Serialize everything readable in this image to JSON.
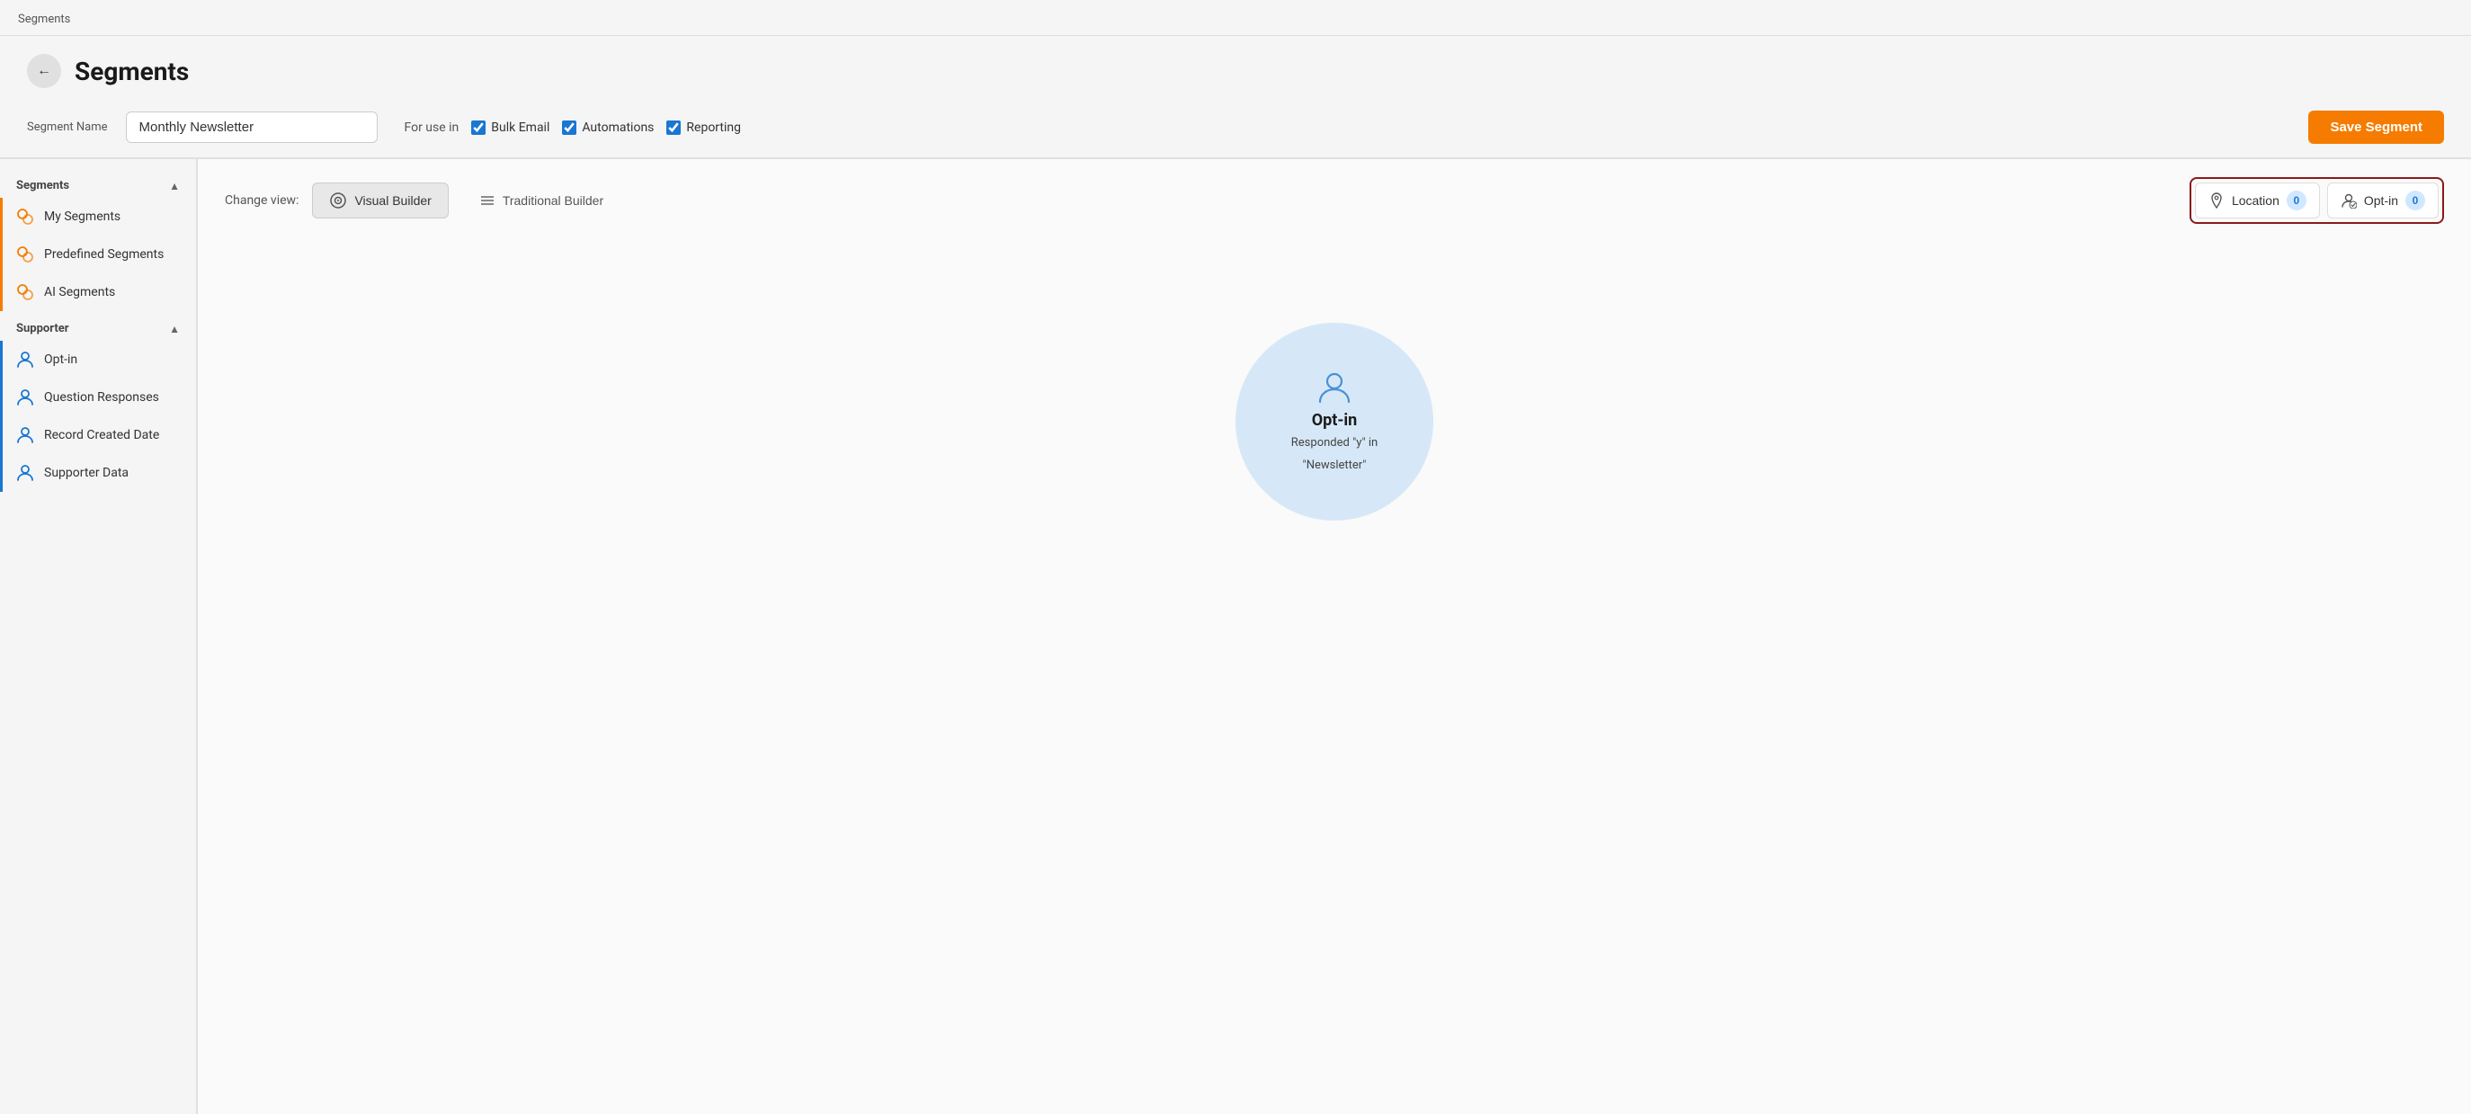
{
  "title_bar": {
    "text": "Segments"
  },
  "header": {
    "back_label": "←",
    "page_title": "Segments"
  },
  "toolbar": {
    "segment_name_label": "Segment Name",
    "segment_name_value": "Monthly Newsletter",
    "segment_name_placeholder": "Enter segment name",
    "for_use_in_label": "For use in",
    "checkboxes": [
      {
        "id": "bulk-email",
        "label": "Bulk Email",
        "checked": true
      },
      {
        "id": "automations",
        "label": "Automations",
        "checked": true
      },
      {
        "id": "reporting",
        "label": "Reporting",
        "checked": true
      }
    ],
    "save_btn_label": "Save Segment"
  },
  "sidebar": {
    "sections": [
      {
        "title": "Segments",
        "items": [
          {
            "id": "my-segments",
            "label": "My Segments",
            "icon_type": "orange"
          },
          {
            "id": "predefined-segments",
            "label": "Predefined Segments",
            "icon_type": "orange"
          },
          {
            "id": "ai-segments",
            "label": "AI Segments",
            "icon_type": "orange"
          }
        ]
      },
      {
        "title": "Supporter",
        "items": [
          {
            "id": "opt-in",
            "label": "Opt-in",
            "icon_type": "blue"
          },
          {
            "id": "question-responses",
            "label": "Question Responses",
            "icon_type": "blue"
          },
          {
            "id": "record-created-date",
            "label": "Record Created Date",
            "icon_type": "blue"
          },
          {
            "id": "supporter-data",
            "label": "Supporter Data",
            "icon_type": "blue"
          }
        ]
      }
    ]
  },
  "content": {
    "change_view_label": "Change view:",
    "view_buttons": [
      {
        "id": "visual-builder",
        "label": "Visual Builder",
        "active": true
      },
      {
        "id": "traditional-builder",
        "label": "Traditional Builder",
        "active": false
      }
    ],
    "badges": [
      {
        "id": "location",
        "label": "Location",
        "count": 0
      },
      {
        "id": "opt-in",
        "label": "Opt-in",
        "count": 0
      }
    ],
    "circle": {
      "title": "Opt-in",
      "line1": "Responded \"y\" in",
      "line2": "\"Newsletter\""
    }
  }
}
